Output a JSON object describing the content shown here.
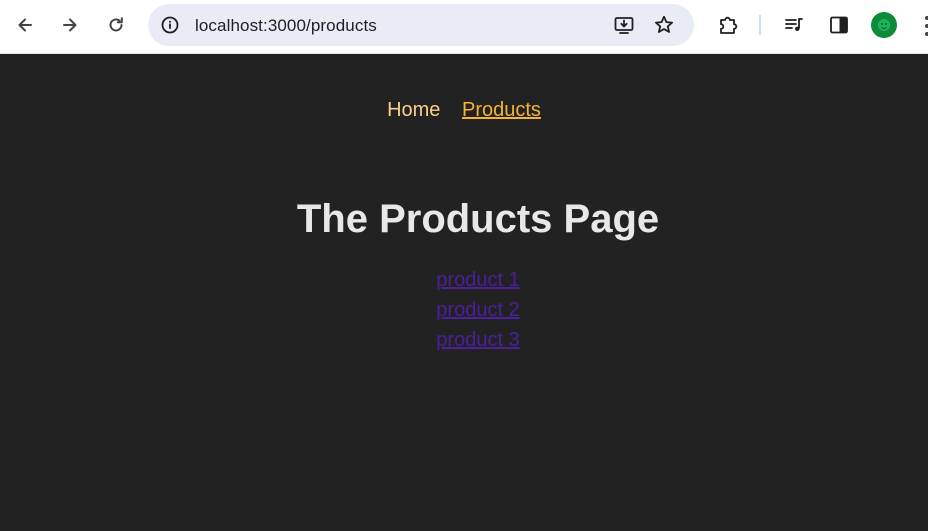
{
  "browser": {
    "url": "localhost:3000/products",
    "icons": [
      "back-icon",
      "forward-icon",
      "reload-icon",
      "site-info-icon",
      "install-app-icon",
      "bookmark-star-icon",
      "extensions-icon",
      "media-controls-icon",
      "side-panel-icon",
      "profile-avatar",
      "more-menu-icon"
    ],
    "avatar_color": "#0f8a3a"
  },
  "nav": {
    "home_label": "Home",
    "products_label": "Products"
  },
  "main": {
    "title": "The Products Page",
    "products": [
      "product 1",
      "product 2",
      "product 3"
    ]
  },
  "colors": {
    "background": "#222222",
    "nav_link": "#f7d08a",
    "nav_active": "#f5b335",
    "product_link": "#4b1f9a",
    "title": "#e8e8e8"
  }
}
